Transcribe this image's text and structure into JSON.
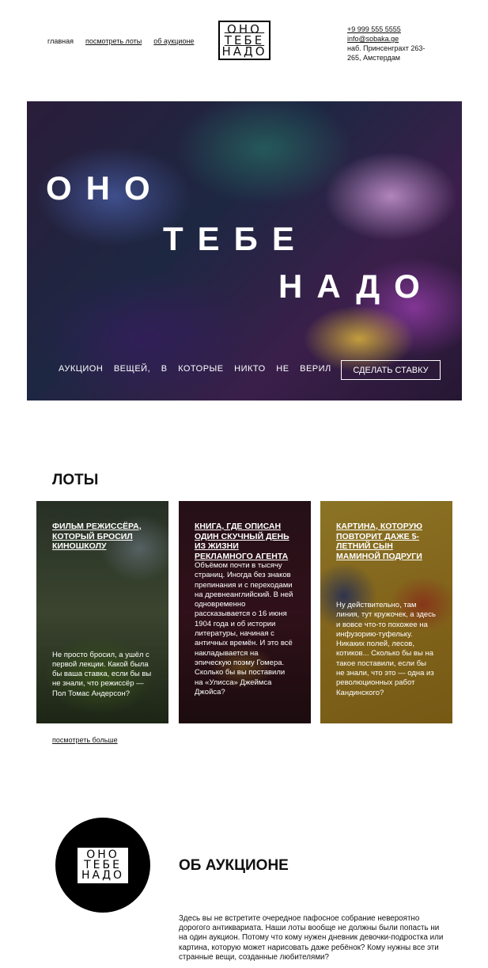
{
  "header": {
    "nav": [
      "главная",
      "посмотреть лоты",
      "об аукционе"
    ],
    "logo": [
      "ОНО",
      "ТЕБЕ",
      "НАДО"
    ],
    "contacts": {
      "phone": "+9 999 555 5555",
      "email": "info@sobaka.ge",
      "address1": "наб. Принсенграхт 263-",
      "address2": "265, Амстердам"
    }
  },
  "hero": {
    "line1": "ОНО",
    "line2": "ТЕБЕ",
    "line3": "НАДО",
    "tagline": "АУКЦИОН ВЕЩЕЙ, В КОТОРЫЕ НИКТО НЕ ВЕРИЛ",
    "cta": "СДЕЛАТЬ СТАВКУ"
  },
  "lots": {
    "title": "ЛОТЫ",
    "cards": [
      {
        "title": "Фильм режиссёра, который бросил киношколу",
        "desc": "Не просто бросил, а ушёл с первой лекции. Какой была бы ваша ставка, если бы вы не знали, что режиссёр — Пол Томас Андерсон?"
      },
      {
        "title": "Книга, где описан один скучный день из жизни рекламного агента",
        "desc": "Объёмом почти в тысячу страниц. Иногда без знаков препинания и с переходами на древнеанглийский. В ней одновременно рассказывается о 16 июня 1904 года и об истории литературы, начиная с античных времён. И это всё накладывается на эпическую поэму Гомера. Сколько бы вы поставили на «Улисса» Джеймса Джойса?"
      },
      {
        "title": "Картина, которую повторит даже 5-летний сын маминой подруги",
        "desc": "Ну действительно, там линия, тут кружочек, а здесь и вовсе что-то похожее на инфузорию-туфельку. Никаких полей, лесов, котиков... Сколько бы вы на такое поставили, если бы не знали, что это — одна из революционных работ Кандинского?"
      }
    ],
    "more": "посмотреть больше"
  },
  "about": {
    "title": "ОБ АУКЦИОНЕ",
    "text": "Здесь вы не встретите очередное пафосное собрание невероятно дорогого антиквариата. Наши лоты вообще не должны были попасть ни на один аукцион. Потому что кому нужен дневник девочки-подростка или картина, которую может нарисовать даже ребёнок? Кому нужны все эти странные вещи, созданные любителями?"
  }
}
